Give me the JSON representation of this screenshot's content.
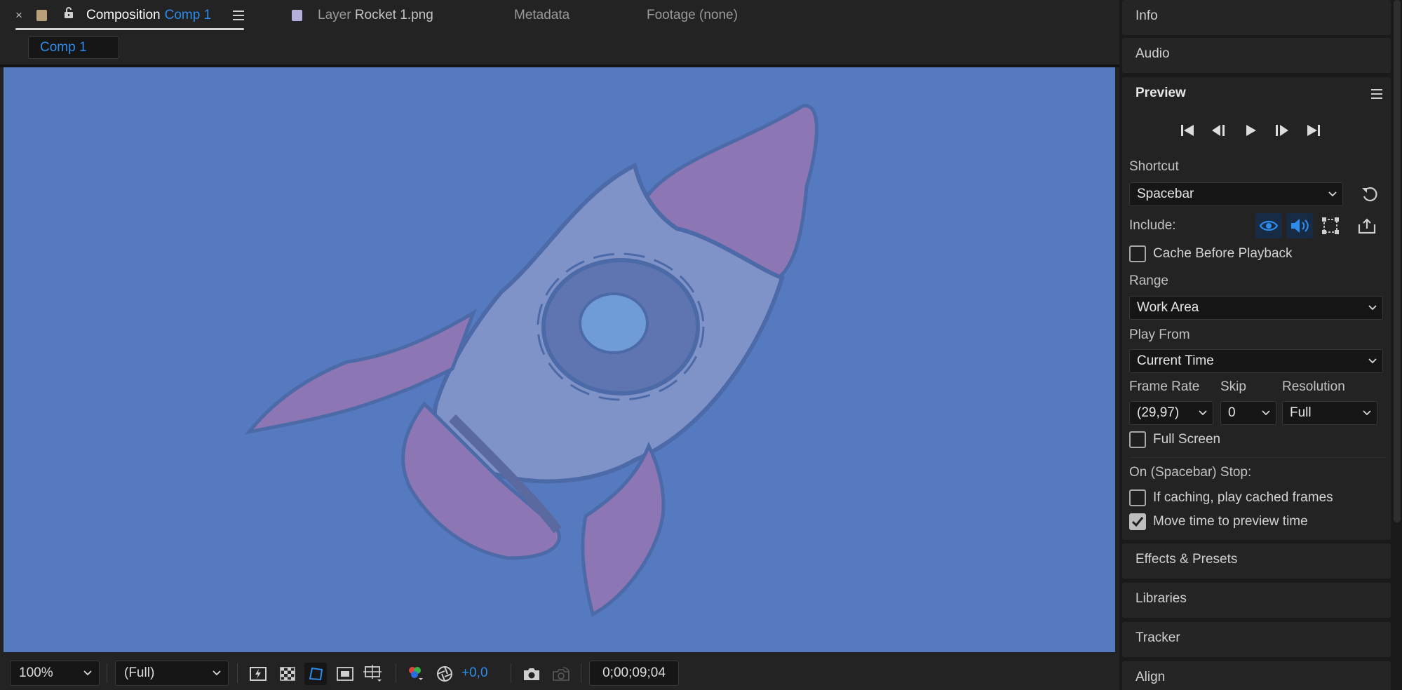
{
  "tabs": {
    "composition": {
      "prefix": "Composition",
      "name": "Comp 1",
      "swatch_color": "#b8a07a"
    },
    "layer": {
      "prefix": "Layer",
      "name": "Rocket 1.png",
      "swatch_color": "#b4b0dc"
    },
    "metadata": {
      "label": "Metadata"
    },
    "footage": {
      "label": "Footage (none)"
    },
    "close_glyph": "×"
  },
  "sub_tab": {
    "label": "Comp 1"
  },
  "viewer": {
    "background": "#567abf"
  },
  "bottom_bar": {
    "zoom": "100%",
    "resolution": "(Full)",
    "exposure": "+0,0",
    "timecode": "0;00;09;04"
  },
  "right_panel": {
    "info": "Info",
    "audio": "Audio",
    "effects_presets": "Effects & Presets",
    "libraries": "Libraries",
    "tracker": "Tracker",
    "align": "Align"
  },
  "preview": {
    "title": "Preview",
    "shortcut_label": "Shortcut",
    "shortcut_value": "Spacebar",
    "include_label": "Include:",
    "cache_before_playback": {
      "label": "Cache Before Playback",
      "checked": false
    },
    "range_label": "Range",
    "range_value": "Work Area",
    "play_from_label": "Play From",
    "play_from_value": "Current Time",
    "frame_rate_label": "Frame Rate",
    "frame_rate_value": "(29,97)",
    "skip_label": "Skip",
    "skip_value": "0",
    "resolution_label": "Resolution",
    "resolution_value": "Full",
    "full_screen": {
      "label": "Full Screen",
      "checked": false
    },
    "on_stop_label": "On (Spacebar) Stop:",
    "if_caching": {
      "label": "If caching, play cached frames",
      "checked": false
    },
    "move_time": {
      "label": "Move time to preview time",
      "checked": true
    }
  },
  "colors": {
    "accent": "#2d8ceb",
    "panel": "#232323"
  }
}
